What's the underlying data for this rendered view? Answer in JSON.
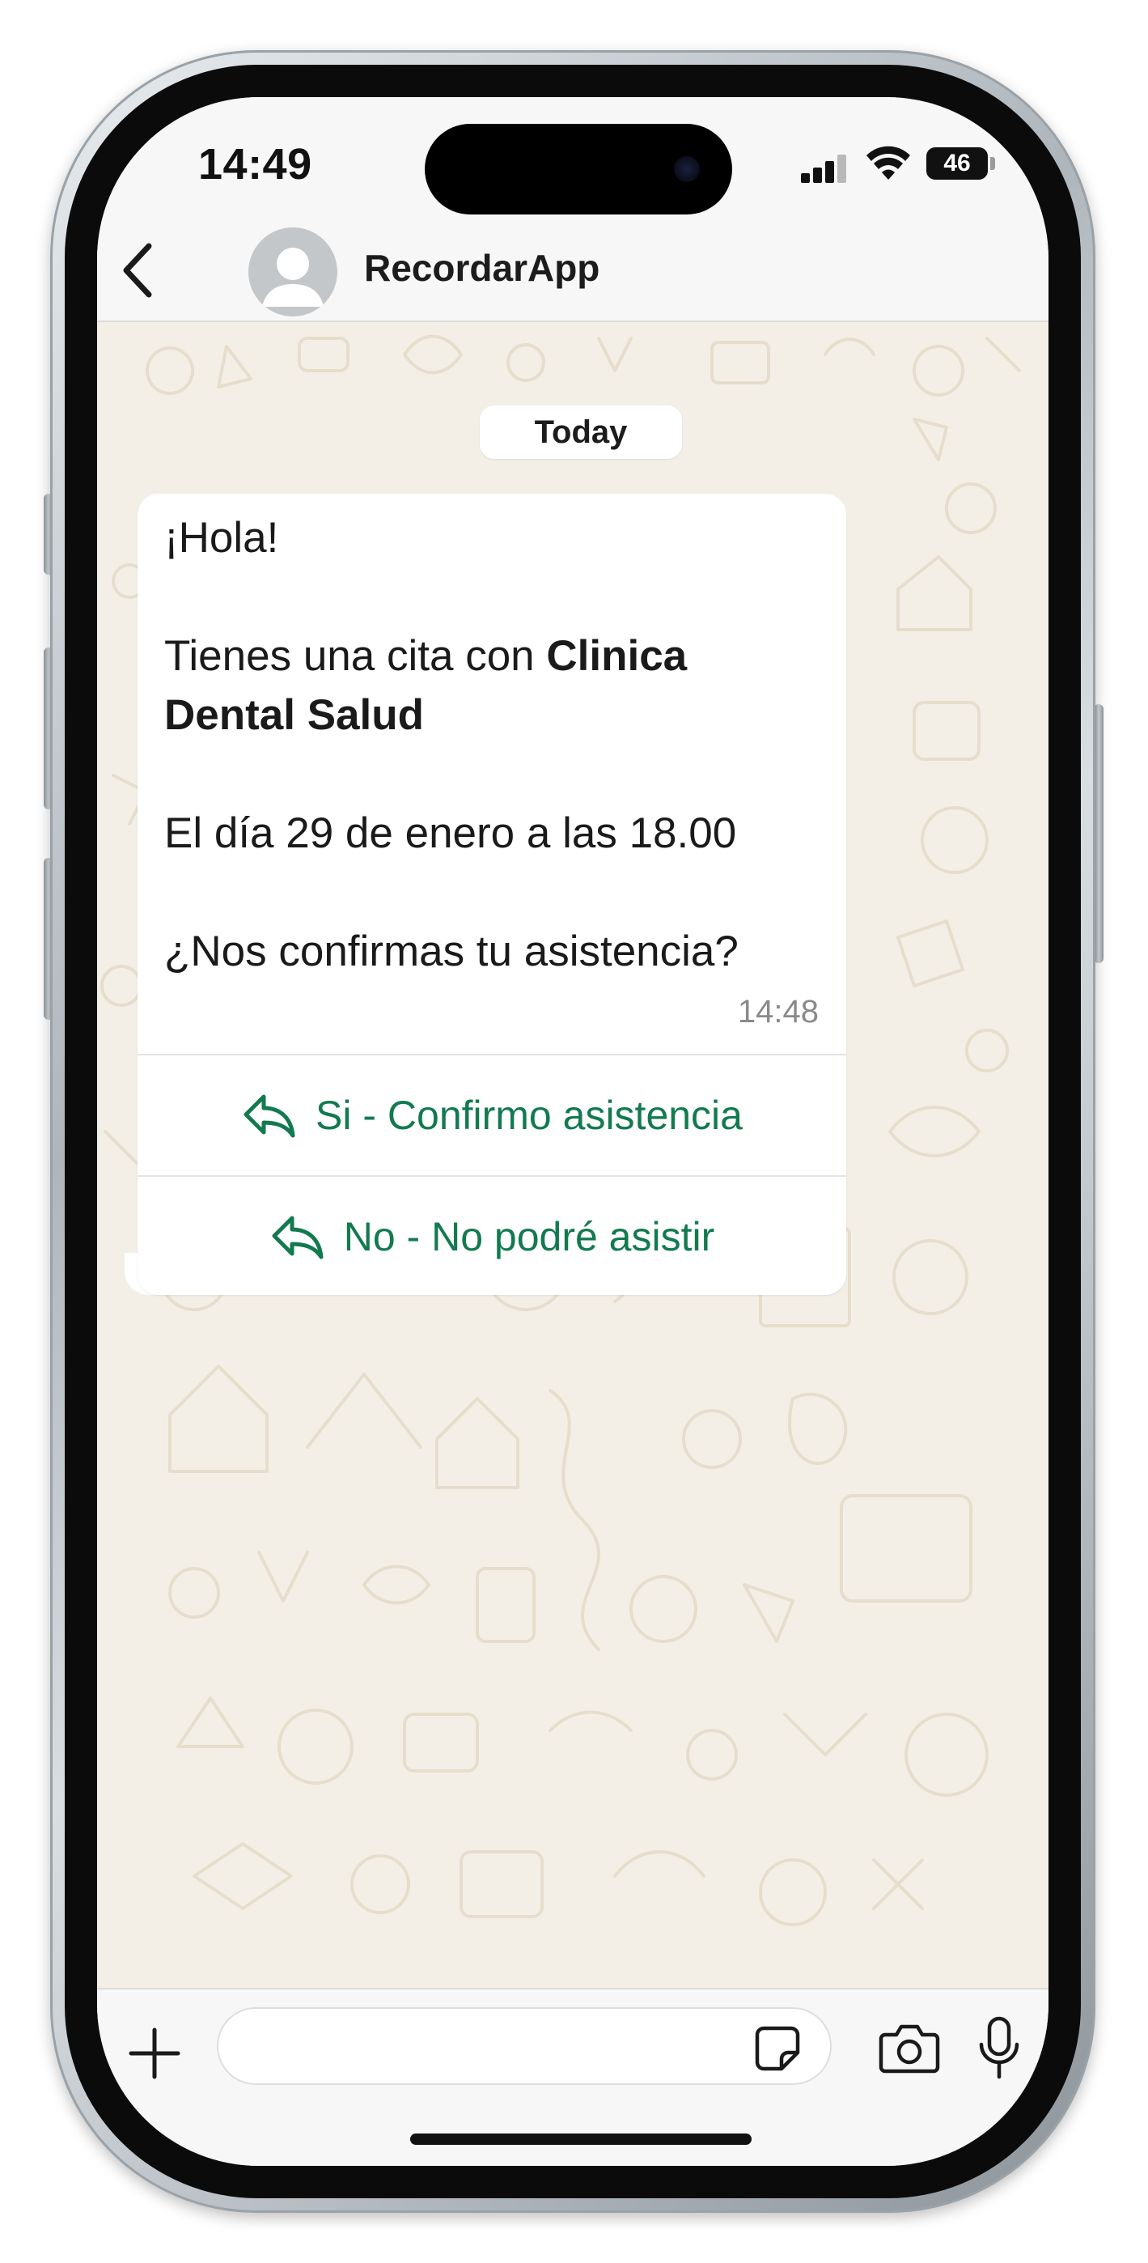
{
  "status_bar": {
    "time": "14:49",
    "battery": "46"
  },
  "header": {
    "contact_name": "RecordarApp",
    "icons": [
      "chevron-left-icon",
      "person-avatar-icon"
    ]
  },
  "chat": {
    "date_chip": "Today",
    "message": {
      "greeting": "¡Hola!",
      "line1_prefix": "Tienes una cita con ",
      "line1_bold": "Clinica Dental Salud",
      "line2": "El día 29 de enero a las 18.00",
      "line3": "¿Nos confirmas tu asistencia?",
      "time": "14:48"
    },
    "quick_replies": [
      {
        "label": "Si - Confirmo asistencia",
        "icon": "reply-arrow-icon"
      },
      {
        "label": "No - No podré asistir",
        "icon": "reply-arrow-icon"
      }
    ]
  },
  "input_bar": {
    "placeholder": "",
    "icons": [
      "plus-icon",
      "sticker-icon",
      "camera-icon",
      "microphone-icon"
    ]
  },
  "colors": {
    "accent_green": "#137a50",
    "chat_background": "#f4efe6",
    "bubble": "#ffffff",
    "bars": "#f7f7f7"
  }
}
